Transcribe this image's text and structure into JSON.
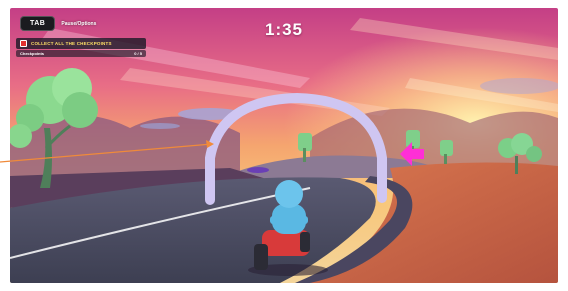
{
  "hud": {
    "tab_key": "TAB",
    "tab_hint": "Pause/Options",
    "timer": "1:35",
    "objective": {
      "title": "COLLECT ALL THE CHECKPOINTS",
      "row_label": "Checkpoints",
      "row_progress": "0 / 5"
    }
  },
  "colors": {
    "objective_title": "#ffe066",
    "arrow": "#ff2fd6",
    "annotation_line": "#f08a3a",
    "checkpoint_arch": "#cfc6f2"
  },
  "scene": {
    "setting": "sunset racetrack with checkpoint arch",
    "player_vehicle": "blue character on red kart"
  }
}
